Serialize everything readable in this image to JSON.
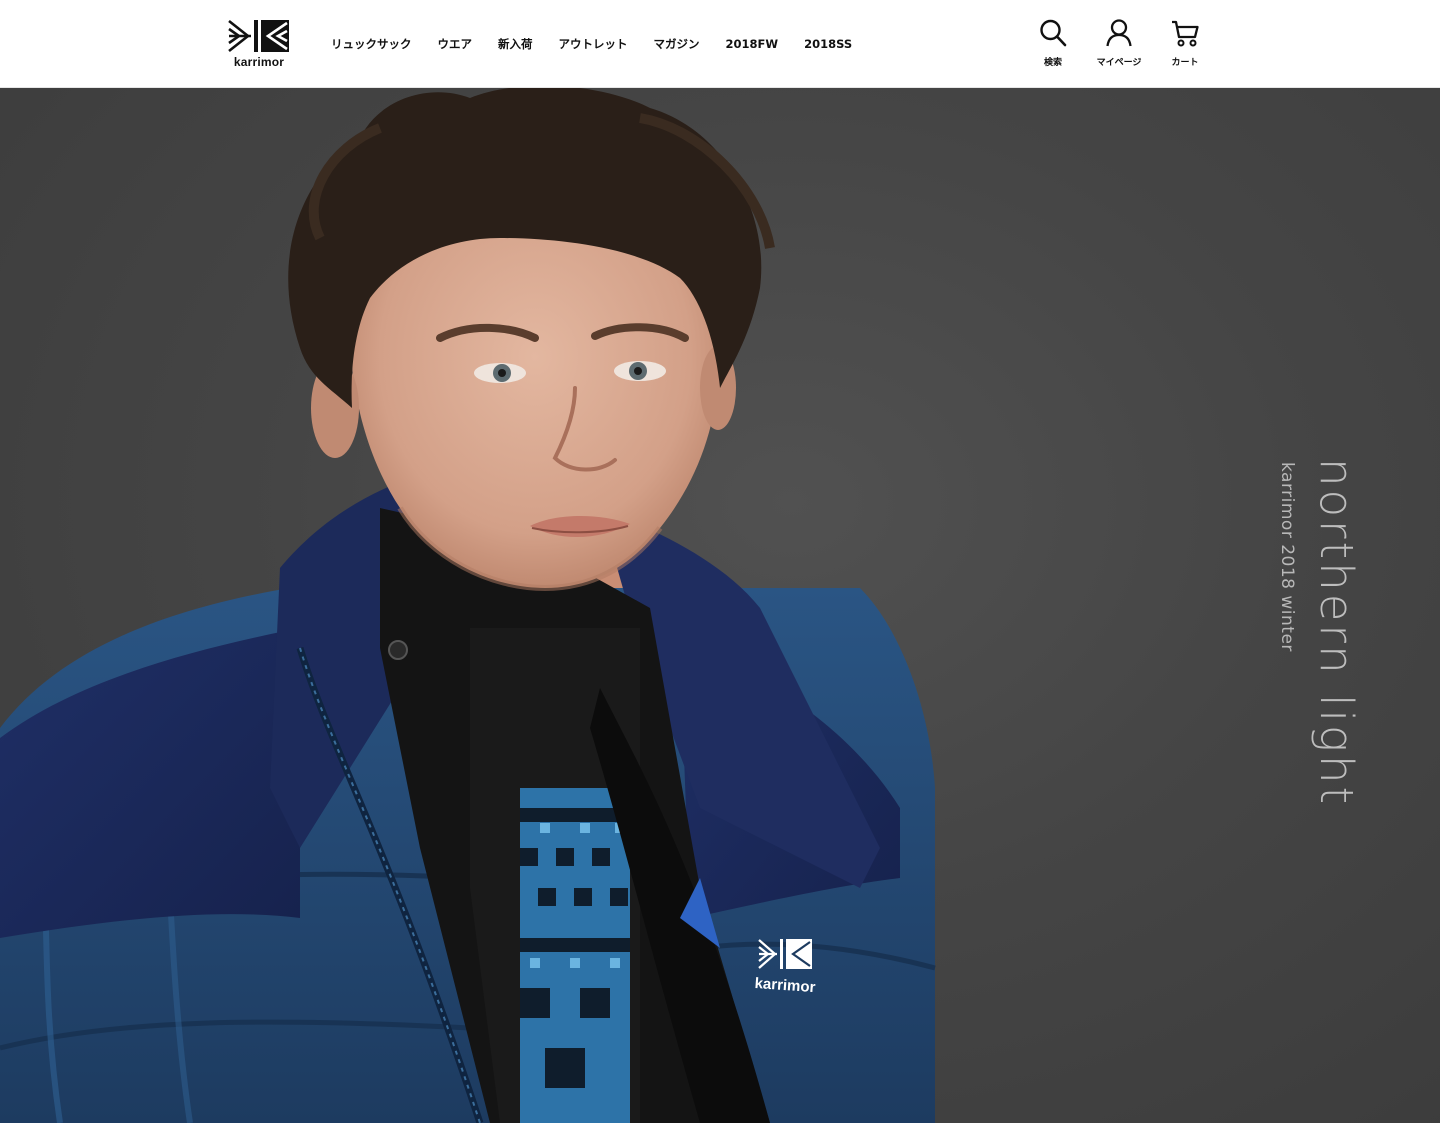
{
  "brand": {
    "name": "karrimor"
  },
  "nav": {
    "items": [
      {
        "label": "リュックサック"
      },
      {
        "label": "ウエア"
      },
      {
        "label": "新入荷"
      },
      {
        "label": "アウトレット"
      },
      {
        "label": "マガジン"
      },
      {
        "label": "2018FW"
      },
      {
        "label": "2018SS"
      }
    ]
  },
  "tools": {
    "search_label": "検索",
    "mypage_label": "マイページ",
    "cart_label": "カート"
  },
  "hero": {
    "title": "northern light",
    "subtitle": "karrimor 2018 winter",
    "jacket_logo_text": "karrimor"
  },
  "colors": {
    "header_bg": "#ffffff",
    "hero_bg": "#454545",
    "jacket_navy": "#1c2a5a",
    "jacket_blue": "#22456e",
    "tagline": "#bdbdbd"
  }
}
